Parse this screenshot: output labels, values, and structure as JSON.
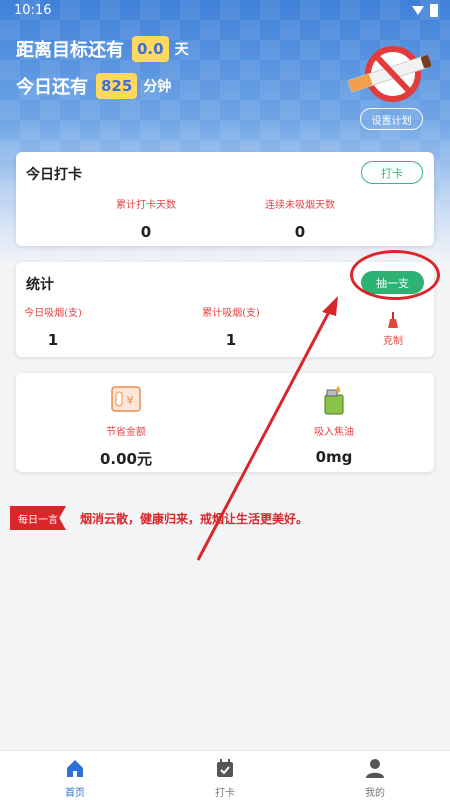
{
  "status_bar": {
    "time": "10:16"
  },
  "header": {
    "goal_label": "距离目标还有",
    "goal_value": "0.0",
    "goal_unit": "天",
    "today_label": "今日还有",
    "today_value": "825",
    "today_unit": "分钟",
    "plan_button": "设置计划"
  },
  "checkin_card": {
    "title": "今日打卡",
    "button": "打卡",
    "total_days_label": "累计打卡天数",
    "total_days_value": "0",
    "streak_label": "连续未吸烟天数",
    "streak_value": "0"
  },
  "stats_card": {
    "title": "统计",
    "smoke_button": "抽一支",
    "today_label": "今日吸烟(支)",
    "today_value": "1",
    "total_label": "累计吸烟(支)",
    "total_value": "1",
    "resist_label": "克制"
  },
  "savings_card": {
    "money_label": "节省金额",
    "money_value": "0.00元",
    "tar_label": "吸入焦油",
    "tar_value": "0mg"
  },
  "motto": {
    "ribbon": "每日一言",
    "text": "烟消云散，健康归来，戒烟让生活更美好。"
  },
  "tabbar": {
    "home": "首页",
    "checkin": "打卡",
    "mine": "我的"
  },
  "colors": {
    "accent_blue": "#2f6fd8",
    "green": "#2eb274",
    "red": "#e64545",
    "yellow_box": "#ffd95e"
  }
}
